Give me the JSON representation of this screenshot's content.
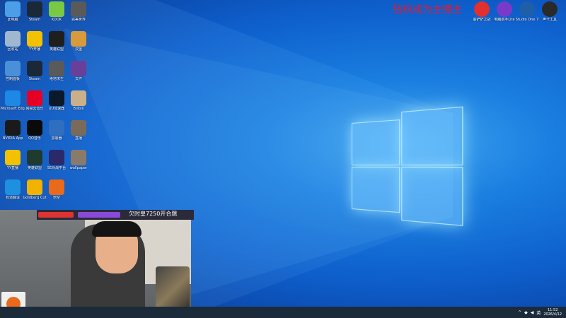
{
  "desktop": {
    "icons": [
      {
        "label": "此电脑",
        "icon": "computer-icon",
        "color": "#4a9fe8"
      },
      {
        "label": "Steam",
        "icon": "steam-icon",
        "color": "#1b2838"
      },
      {
        "label": "KOOK",
        "icon": "kook-icon",
        "color": "#7ac943"
      },
      {
        "label": "完美世界",
        "icon": "perfect-world-icon",
        "color": "#5a5a5a"
      },
      {
        "label": "回收站",
        "icon": "recycle-bin-icon",
        "color": "#9fb8d0"
      },
      {
        "label": "YY开播",
        "icon": "yy-icon",
        "color": "#f2c200"
      },
      {
        "label": "英雄联盟",
        "icon": "valorant-icon",
        "color": "#1f1f1f"
      },
      {
        "label": "汉堡",
        "icon": "burger-icon",
        "color": "#d89a3a"
      },
      {
        "label": "控制面板",
        "icon": "control-panel-icon",
        "color": "#4a90d9"
      },
      {
        "label": "Steam",
        "icon": "steam-icon",
        "color": "#1b2838"
      },
      {
        "label": "绝地求生",
        "icon": "pubg-icon",
        "color": "#5a5a5a"
      },
      {
        "label": "文件",
        "icon": "file-icon",
        "color": "#6a3f9a"
      },
      {
        "label": "Microsoft Edge",
        "icon": "edge-icon",
        "color": "#1e88e5"
      },
      {
        "label": "网易云音乐",
        "icon": "netease-music-icon",
        "color": "#e60026"
      },
      {
        "label": "UU加速器",
        "icon": "uu-icon",
        "color": "#0a1a2a"
      },
      {
        "label": "Bilibili",
        "icon": "avatar-icon",
        "color": "#c9b08a"
      },
      {
        "label": "NVIDIA App",
        "icon": "nvidia-icon",
        "color": "#1a1a1a"
      },
      {
        "label": "QQ音乐",
        "icon": "qq-music-icon",
        "color": "#0a0a0a"
      },
      {
        "label": "加速器",
        "icon": "speed-icon",
        "color": "#2f6fbf"
      },
      {
        "label": "直播",
        "icon": "photo-icon",
        "color": "#7a6a5a"
      },
      {
        "label": "YY直播",
        "icon": "yy-live-icon",
        "color": "#f2c200"
      },
      {
        "label": "英雄联盟",
        "icon": "triangle-icon",
        "color": "#1f3a2f"
      },
      {
        "label": "5E对战平台",
        "icon": "5e-icon",
        "color": "#2a2a6a"
      },
      {
        "label": "wallpaper",
        "icon": "photo-icon",
        "color": "#8a7a6a"
      },
      {
        "label": "有道翻译",
        "icon": "translate-icon",
        "color": "#1e90e0"
      },
      {
        "label": "Goldberg Cut",
        "icon": "goldberg-icon",
        "color": "#f2b200"
      },
      {
        "label": "悟空",
        "icon": "goku-icon",
        "color": "#e86a1a"
      }
    ],
    "top_right_icons": [
      {
        "label": "金铲铲之战",
        "icon": "game-icon",
        "color": "#e03030"
      },
      {
        "label": "电脑助手Lite",
        "icon": "assistant-icon",
        "color": "#7a3ac9"
      },
      {
        "label": "Studio One 7",
        "icon": "studio-one-icon",
        "color": "#1e5fa8"
      },
      {
        "label": "声卡工具",
        "icon": "sound-card-icon",
        "color": "#2a2a2a"
      }
    ],
    "banner_text": "钻粉成为主播主"
  },
  "stream_overlay": {
    "bar_text": "欠时皇7250开合跳"
  },
  "taskbar": {
    "time": "11:52",
    "date": "2026/4/12",
    "ime": "英"
  }
}
